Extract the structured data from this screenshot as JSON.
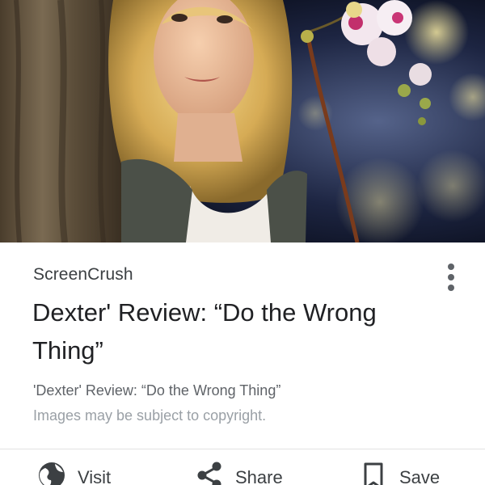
{
  "card": {
    "source": "ScreenCrush",
    "title": "Dexter' Review: “Do the Wrong Thing”",
    "subtitle": "'Dexter' Review: “Do the Wrong Thing”",
    "copyright_notice": "Images may be subject to copyright.",
    "menu_icon": "more-vert-icon"
  },
  "actions": [
    {
      "label": "Visit",
      "icon": "globe-icon"
    },
    {
      "label": "Share",
      "icon": "share-icon"
    },
    {
      "label": "Save",
      "icon": "bookmark-icon"
    }
  ],
  "colors": {
    "title_text": "#202124",
    "source_text": "#3c4043",
    "secondary_text": "#5f6368",
    "muted_text": "#9aa0a6",
    "divider": "#e3e3e3",
    "icon": "#3c4043"
  }
}
